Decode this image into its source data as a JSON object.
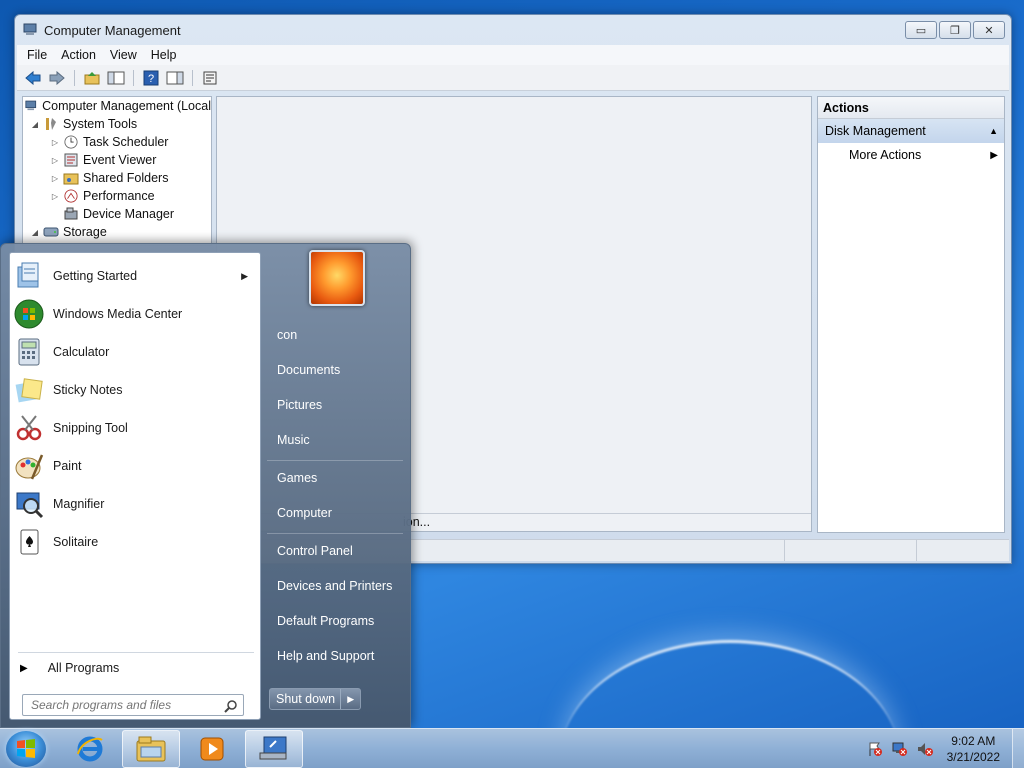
{
  "window": {
    "title": "Computer Management",
    "buttons": {
      "minimize": "▭",
      "maximize": "❐",
      "close": "✕"
    },
    "menu": [
      "File",
      "Action",
      "View",
      "Help"
    ]
  },
  "tree": {
    "root": "Computer Management (Local",
    "system_tools": "System Tools",
    "task_scheduler": "Task Scheduler",
    "event_viewer": "Event Viewer",
    "shared_folders": "Shared Folders",
    "performance": "Performance",
    "device_manager": "Device Manager",
    "storage": "Storage"
  },
  "center": {
    "status_text": "ion..."
  },
  "actions": {
    "header": "Actions",
    "section": "Disk Management",
    "more": "More Actions"
  },
  "start_menu": {
    "programs": [
      {
        "label": "Getting Started",
        "icon": "getting-started-icon",
        "has_submenu": true
      },
      {
        "label": "Windows Media Center",
        "icon": "media-center-icon"
      },
      {
        "label": "Calculator",
        "icon": "calculator-icon"
      },
      {
        "label": "Sticky Notes",
        "icon": "sticky-notes-icon"
      },
      {
        "label": "Snipping Tool",
        "icon": "snipping-tool-icon"
      },
      {
        "label": "Paint",
        "icon": "paint-icon"
      },
      {
        "label": "Magnifier",
        "icon": "magnifier-icon"
      },
      {
        "label": "Solitaire",
        "icon": "solitaire-icon"
      }
    ],
    "all_programs": "All Programs",
    "search_placeholder": "Search programs and files",
    "places": [
      "con",
      "Documents",
      "Pictures",
      "Music",
      "Games",
      "Computer",
      "Control Panel",
      "Devices and Printers",
      "Default Programs",
      "Help and Support"
    ],
    "shutdown": "Shut down"
  },
  "taskbar": {
    "clock_time": "9:02 AM",
    "clock_date": "3/21/2022",
    "apps": [
      "internet-explorer-icon",
      "windows-explorer-icon",
      "media-player-icon",
      "computer-management-icon"
    ]
  }
}
